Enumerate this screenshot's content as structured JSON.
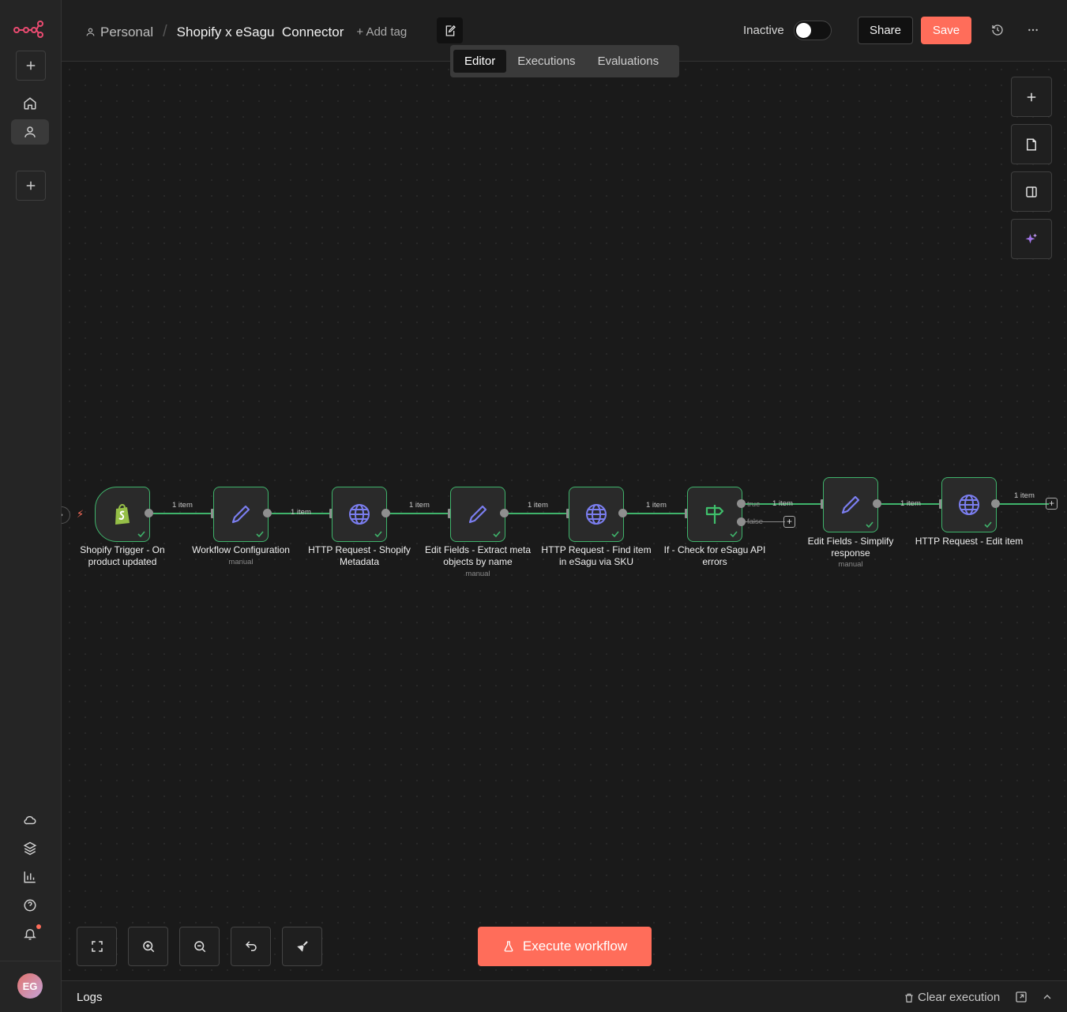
{
  "header": {
    "project": "Personal",
    "workflow_name": "Shopify x eSagu  Connector",
    "add_tag": "+ Add tag",
    "status_label": "Inactive",
    "share_label": "Share",
    "save_label": "Save",
    "tabs": [
      {
        "label": "Editor",
        "active": true
      },
      {
        "label": "Executions",
        "active": false
      },
      {
        "label": "Evaluations",
        "active": false
      }
    ]
  },
  "sidebar": {
    "avatar_initials": "EG"
  },
  "workflow": {
    "nodes": [
      {
        "label": "Shopify Trigger - On product updated",
        "sub": "",
        "icon": "shopify-icon"
      },
      {
        "label": "Workflow Configuration",
        "sub": "manual",
        "icon": "pencil-icon"
      },
      {
        "label": "HTTP Request - Shopify Metadata",
        "sub": "",
        "icon": "globe-icon"
      },
      {
        "label": "Edit Fields - Extract meta objects by name",
        "sub": "manual",
        "icon": "pencil-icon"
      },
      {
        "label": "HTTP Request - Find item in eSagu via SKU",
        "sub": "",
        "icon": "globe-icon"
      },
      {
        "label": "If - Check for eSagu API errors",
        "sub": "",
        "icon": "signpost-icon"
      },
      {
        "label": "Edit Fields - Simplify response",
        "sub": "manual",
        "icon": "pencil-icon"
      },
      {
        "label": "HTTP Request - Edit item",
        "sub": "",
        "icon": "globe-icon"
      }
    ],
    "connections": {
      "item_label": "1 item",
      "true_label": "true",
      "false_label": "false"
    }
  },
  "footer": {
    "execute_label": "Execute workflow",
    "logs_label": "Logs",
    "clear_label": "Clear execution"
  }
}
